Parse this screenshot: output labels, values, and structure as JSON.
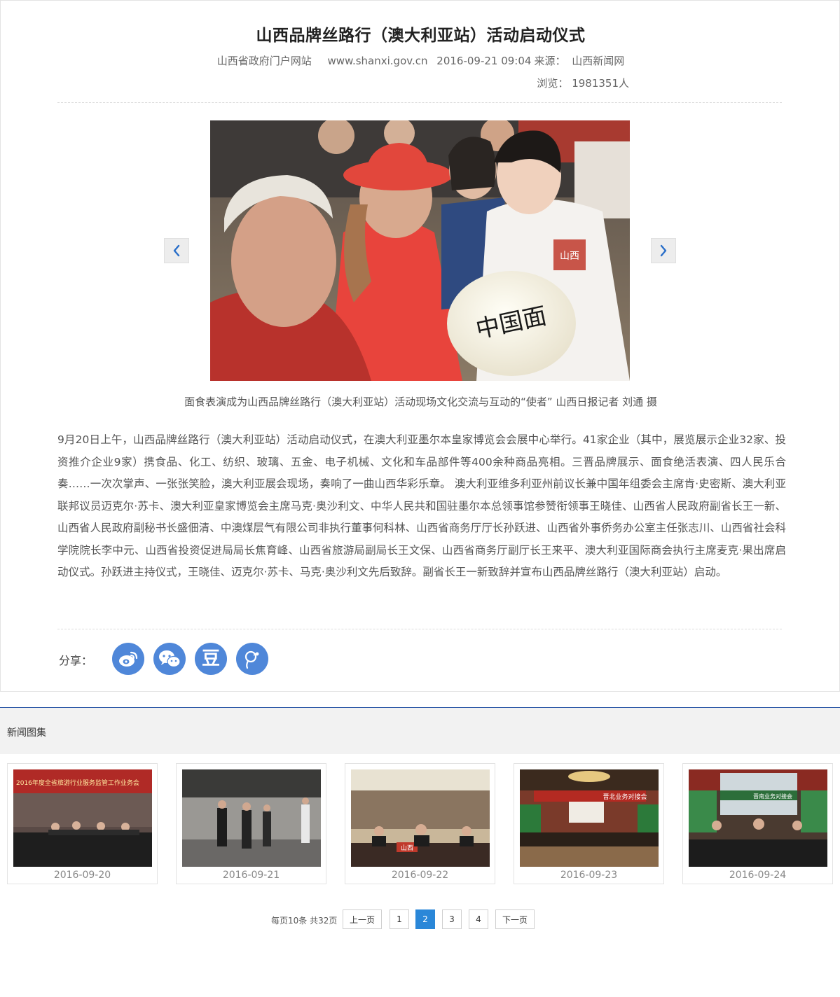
{
  "article": {
    "title": "山西品牌丝路行（澳大利亚站）活动启动仪式",
    "meta": {
      "site": "山西省政府门户网站",
      "url": "www.shanxi.gov.cn",
      "datetime": "2016-09-21 09:04",
      "source_label": "来源：",
      "source": "山西新闻网"
    },
    "views": "浏览： 1981351人",
    "photo_caption": "面食表演成为山西品牌丝路行（澳大利亚站）活动现场文化交流与互动的“使者” 山西日报记者 刘通 摄",
    "body": "9月20日上午，山西品牌丝路行（澳大利亚站）活动启动仪式，在澳大利亚墨尔本皇家博览会会展中心举行。41家企业（其中，展览展示企业32家、投资推介企业9家）携食品、化工、纺织、玻璃、五金、电子机械、文化和车品部件等400余种商品亮相。三晋品牌展示、面食绝活表演、四人民乐合奏……一次次掌声、一张张笑脸，澳大利亚展会现场，奏响了一曲山西华彩乐章。 澳大利亚维多利亚州前议长兼中国年组委会主席肯·史密斯、澳大利亚联邦议员迈克尔·苏卡、澳大利亚皇家博览会主席马克·奥沙利文、中华人民共和国驻墨尔本总领事馆参赞衔领事王晓佳、山西省人民政府副省长王一新、山西省人民政府副秘书长盛佃清、中澳煤层气有限公司非执行董事何科林、山西省商务厅厅长孙跃进、山西省外事侨务办公室主任张志川、山西省社会科学院院长李中元、山西省投资促进局局长焦育峰、山西省旅游局副局长王文保、山西省商务厅副厅长王来平、澳大利亚国际商会执行主席麦克·果出席启动仪式。孙跃进主持仪式，王晓佳、迈克尔·苏卡、马克·奥沙利文先后致辞。副省长王一新致辞并宣布山西品牌丝路行（澳大利亚站）启动。",
    "photo_text": "中国面",
    "photo_badge": "山西"
  },
  "share": {
    "label": "分享：",
    "buttons": [
      {
        "icon": "weibo-icon"
      },
      {
        "icon": "wechat-icon"
      },
      {
        "icon": "douban-icon",
        "glyph": "豆"
      },
      {
        "icon": "qzone-icon"
      }
    ]
  },
  "gallery": {
    "title": "新闻图集",
    "items": [
      {
        "date": "2016-09-20",
        "banner": "2016年度全省旅游行业服务监管工作业务会"
      },
      {
        "date": "2016-09-21"
      },
      {
        "date": "2016-09-22",
        "banner": "山西"
      },
      {
        "date": "2016-09-23",
        "banner": "晋北业务对接会"
      },
      {
        "date": "2016-09-24",
        "banner": "晋南业务对接会"
      }
    ]
  },
  "pagination": {
    "info": "每页10条 共32页",
    "prev": "上一页",
    "pages": [
      "1",
      "2",
      "3",
      "4"
    ],
    "current": "2",
    "next": "下一页"
  },
  "colors": {
    "accent": "#4f87d9",
    "gallery_rule": "#2f5aa8",
    "page_active": "#2a87d8"
  }
}
